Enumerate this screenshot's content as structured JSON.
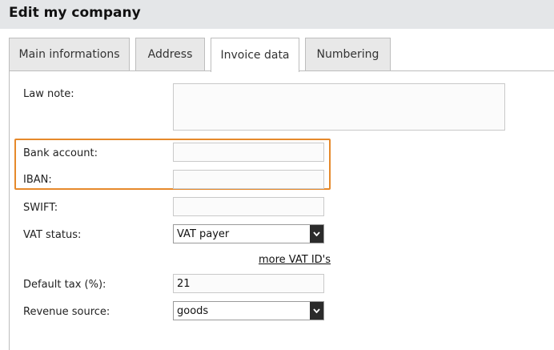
{
  "page": {
    "title": "Edit my company"
  },
  "tabs": [
    {
      "label": "Main informations",
      "active": false
    },
    {
      "label": "Address",
      "active": false
    },
    {
      "label": "Invoice data",
      "active": true
    },
    {
      "label": "Numbering",
      "active": false
    }
  ],
  "form": {
    "law_note": {
      "label": "Law note:",
      "value": ""
    },
    "bank_account": {
      "label": "Bank account:",
      "value": ""
    },
    "iban": {
      "label": "IBAN:",
      "value": ""
    },
    "swift": {
      "label": "SWIFT:",
      "value": ""
    },
    "vat_status": {
      "label": "VAT status:",
      "selected": "VAT payer"
    },
    "more_vat_ids": {
      "label": "more VAT ID's"
    },
    "default_tax": {
      "label": "Default tax (%):",
      "value": "21"
    },
    "revenue_source": {
      "label": "Revenue source:",
      "selected": "goods"
    }
  },
  "colors": {
    "highlight": "#e6892b",
    "header_bg": "#e4e6e8"
  }
}
